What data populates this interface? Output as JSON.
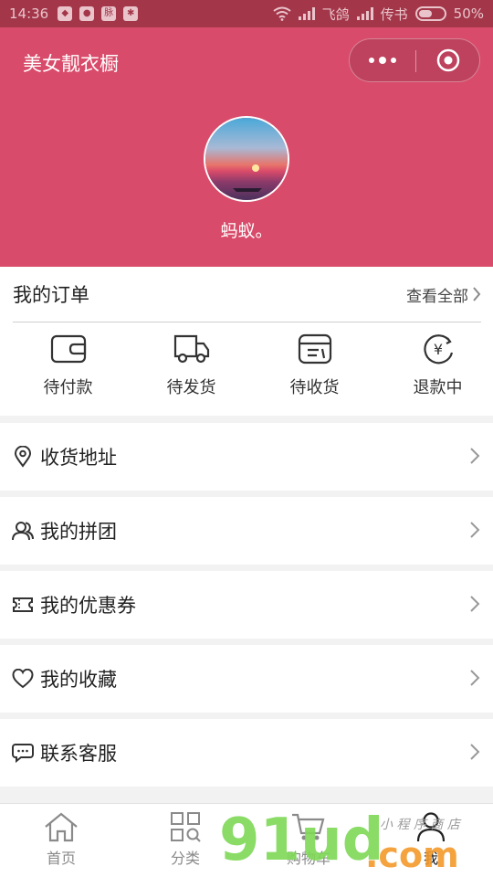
{
  "status_bar": {
    "time": "14:36",
    "carrier1": "飞鸽",
    "carrier2": "传书",
    "battery": "50%"
  },
  "header": {
    "app_title": "美女靓衣橱",
    "username": "蚂蚁。",
    "bg_color": "#d94b6a"
  },
  "orders": {
    "title": "我的订单",
    "view_all": "查看全部",
    "items": [
      {
        "label": "待付款",
        "icon": "wallet-icon"
      },
      {
        "label": "待发货",
        "icon": "truck-icon"
      },
      {
        "label": "待收货",
        "icon": "parcel-icon"
      },
      {
        "label": "退款中",
        "icon": "yuan-refund-icon"
      }
    ]
  },
  "menu": [
    {
      "label": "收货地址",
      "icon": "location-pin-icon"
    },
    {
      "label": "我的拼团",
      "icon": "group-users-icon"
    },
    {
      "label": "我的优惠券",
      "icon": "coupon-icon"
    },
    {
      "label": "我的收藏",
      "icon": "heart-icon"
    },
    {
      "label": "联系客服",
      "icon": "chat-bubble-icon"
    }
  ],
  "tabbar": [
    {
      "label": "首页",
      "icon": "home-icon"
    },
    {
      "label": "分类",
      "icon": "category-grid-icon"
    },
    {
      "label": "购物车",
      "icon": "cart-icon"
    },
    {
      "label": "我",
      "icon": "user-icon"
    }
  ],
  "watermark": {
    "main": "91ud",
    "tld": ".com",
    "sub": "小 程 序 商 店"
  }
}
